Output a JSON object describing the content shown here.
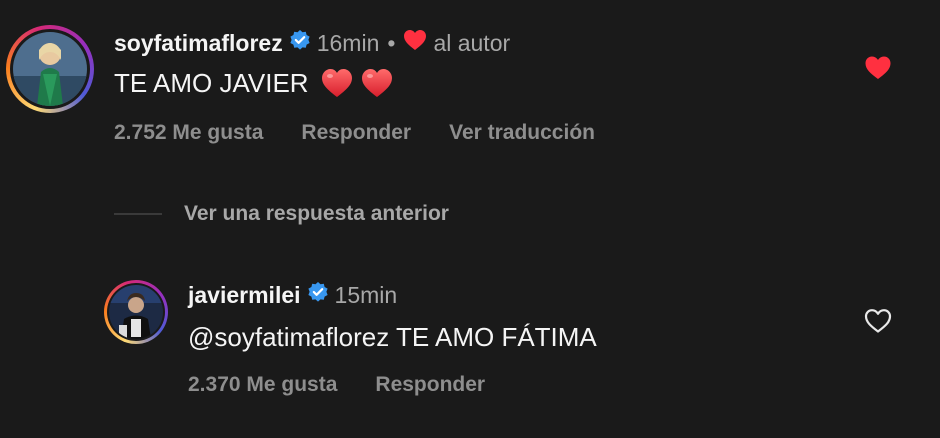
{
  "comments": [
    {
      "username": "soyfatimaflorez",
      "verified": true,
      "time": "16min",
      "separator": "•",
      "liked_by_author_label": "al autor",
      "text": "TE AMO JAVIER",
      "emoji": "❤️ ❤️",
      "likes": "2.752 Me gusta",
      "reply_label": "Responder",
      "translate_label": "Ver traducción",
      "liked": true,
      "avatar_icon": "user-photo-avatar"
    }
  ],
  "replies_toggle": {
    "label": "Ver una respuesta anterior"
  },
  "reply": {
    "username": "javiermilei",
    "verified": true,
    "time": "15min",
    "text": "@soyfatimaflorez TE AMO FÁTIMA",
    "likes": "2.370 Me gusta",
    "reply_label": "Responder",
    "liked": false,
    "avatar_icon": "user-photo-avatar"
  },
  "colors": {
    "background": "#1a1a1a",
    "primary_text": "#f5f5f5",
    "secondary_text": "#a8a8a8",
    "heart_red": "#ff3040",
    "verified_blue": "#3897f0"
  }
}
